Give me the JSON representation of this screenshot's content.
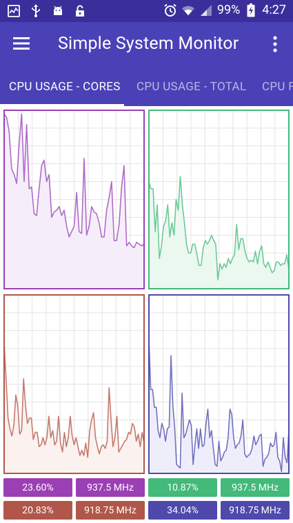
{
  "status_bar": {
    "battery": "99%",
    "time": "4:27",
    "left_icons": [
      "activity-icon",
      "usb-icon",
      "android-icon",
      "lock-icon"
    ],
    "right_icons": [
      "alarm-icon",
      "wifi-icon",
      "signal-icon",
      "battery-charging-icon"
    ]
  },
  "app_bar": {
    "title": "Simple System Monitor",
    "menu_icon": "hamburger-menu-icon",
    "overflow_icon": "more-vertical-icon",
    "background": "#4b41b6"
  },
  "tabs": [
    {
      "label": "CPU USAGE - CORES",
      "active": true
    },
    {
      "label": "CPU USAGE - TOTAL",
      "active": false
    },
    {
      "label": "CPU F",
      "active": false
    }
  ],
  "cores": [
    {
      "color": "#9b3fb5",
      "line": "#b06ac8",
      "fill": "#f5eefa",
      "usage": "23.60%",
      "freq": "937.5 MHz",
      "values": [
        98,
        96,
        88,
        67,
        64,
        59,
        81,
        98,
        60,
        92,
        56,
        57,
        42,
        41,
        56,
        69,
        72,
        60,
        64,
        40,
        43,
        44,
        46,
        41,
        44,
        35,
        29,
        32,
        35,
        54,
        32,
        31,
        73,
        30,
        35,
        46,
        43,
        42,
        37,
        29,
        29,
        44,
        51,
        60,
        27,
        27,
        36,
        57,
        69,
        24,
        26,
        24,
        23,
        26,
        25,
        24,
        25
      ]
    },
    {
      "color": "#43b97a",
      "line": "#6cc995",
      "fill": "#eaf8f0",
      "usage": "10.87%",
      "freq": "937.5 MHz",
      "values": [
        60,
        56,
        56,
        32,
        47,
        17,
        24,
        35,
        38,
        47,
        29,
        37,
        30,
        50,
        44,
        63,
        47,
        37,
        25,
        20,
        20,
        25,
        25,
        19,
        13,
        13,
        23,
        27,
        25,
        27,
        30,
        27,
        25,
        5,
        14,
        11,
        14,
        12,
        17,
        14,
        17,
        19,
        36,
        22,
        28,
        28,
        21,
        17,
        15,
        16,
        15,
        21,
        14,
        21,
        24,
        14,
        12,
        15,
        12,
        9,
        10,
        15,
        15,
        13,
        14,
        14,
        19,
        11
      ]
    },
    {
      "color": "#b0564a",
      "line": "#c47a6e",
      "fill": "#fbf1ef",
      "usage": "20.83%",
      "freq": "918.75 MHz",
      "values": [
        73,
        53,
        31,
        25,
        21,
        27,
        44,
        38,
        22,
        24,
        53,
        38,
        28,
        31,
        31,
        19,
        23,
        23,
        15,
        16,
        20,
        16,
        20,
        32,
        20,
        24,
        16,
        18,
        32,
        17,
        12,
        23,
        15,
        20,
        32,
        21,
        16,
        20,
        15,
        10,
        13,
        10,
        17,
        9,
        24,
        30,
        34,
        20,
        15,
        11,
        15,
        16,
        14,
        18,
        48,
        30,
        15,
        20,
        32,
        12,
        14,
        16,
        18,
        19,
        23,
        22,
        28,
        26,
        18,
        22,
        15,
        23,
        17
      ]
    },
    {
      "color": "#4e49aa",
      "line": "#7271c0",
      "fill": "#eeeefa",
      "usage": "34.04%",
      "freq": "918.75 MHz",
      "values": [
        75,
        47,
        47,
        37,
        37,
        24,
        20,
        28,
        25,
        18,
        25,
        26,
        66,
        38,
        26,
        5,
        4,
        3,
        45,
        20,
        22,
        26,
        30,
        27,
        5,
        16,
        25,
        14,
        25,
        15,
        16,
        28,
        36,
        20,
        24,
        14,
        5,
        4,
        18,
        7,
        9,
        12,
        13,
        20,
        36,
        33,
        20,
        14,
        16,
        17,
        21,
        30,
        11,
        9,
        10,
        11,
        14,
        21,
        16,
        18,
        21,
        22,
        4,
        8,
        9,
        11,
        17,
        15,
        16,
        23,
        9,
        7,
        1,
        20,
        9,
        6,
        24
      ]
    }
  ]
}
